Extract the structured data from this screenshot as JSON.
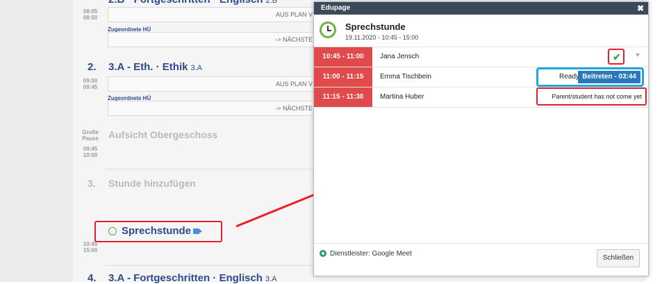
{
  "schedule": {
    "row1": {
      "title": "2.B · Fortgeschritten · Englisch",
      "class": "2.B",
      "time_start": "08:05",
      "time_end": "08:50",
      "status": "AUS PLAN V",
      "hu_label": "Zugeordnete HÜ",
      "next": "-> NÄCHSTE"
    },
    "row2": {
      "num": "2.",
      "title": "3.A - Eth. · Ethik",
      "class": "3.A",
      "time_start": "09:00",
      "time_end": "09:45",
      "status": "AUS PLAN V",
      "hu_label": "Zugeordnete HÜ",
      "next": "-> NÄCHSTE"
    },
    "pause": {
      "label1": "Große",
      "label2": "Pause",
      "title": "Aufsicht Obergeschoss",
      "time_start": "09:45",
      "time_end": "10:00"
    },
    "row3": {
      "num": "3.",
      "title": "Stunde hinzufügen"
    },
    "sprech": {
      "title": "Sprechstunde",
      "time_start": "10:45",
      "time_end": "15:00"
    },
    "row4": {
      "num": "4.",
      "title": "3.A - Fortgeschritten · Englisch",
      "class": "3.A"
    }
  },
  "dialog": {
    "window_title": "Edupage",
    "title": "Sprechstunde",
    "subtitle": "19.11.2020 - 10:45 - 15:00",
    "rows": [
      {
        "slot": "10:45 - 11:00",
        "name": "Jana Jensch"
      },
      {
        "slot": "11:00 - 11:15",
        "name": "Emma Tischbein",
        "status": "Ready",
        "join": "Beitreten - 03:44"
      },
      {
        "slot": "11:15 - 11:30",
        "name": "Martina Huber",
        "message": "Parent/student has not come yet"
      }
    ],
    "provider": "Dienstleister: Google Meet",
    "close_button": "Schließen"
  },
  "colors": {
    "slot_red": "#e14a4a",
    "join_blue": "#2a79bd",
    "highlight_red": "#e0202a",
    "highlight_blue": "#1ea8e0",
    "title_bar": "#3b4a5a"
  }
}
